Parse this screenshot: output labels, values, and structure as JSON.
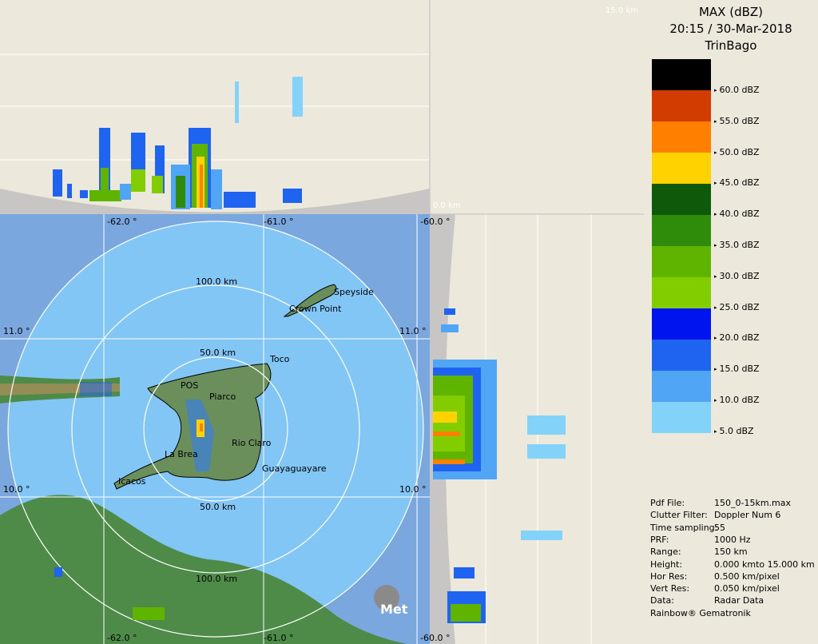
{
  "title": {
    "product": "MAX (dBZ)",
    "datetime": "20:15 / 30-Mar-2018",
    "site": "TrinBago"
  },
  "legend": [
    {
      "label": "60.0 dBZ",
      "color": "#000000"
    },
    {
      "label": "55.0 dBZ",
      "color": "#d23c00"
    },
    {
      "label": "50.0 dBZ",
      "color": "#ff7f00"
    },
    {
      "label": "45.0 dBZ",
      "color": "#ffd200"
    },
    {
      "label": "40.0 dBZ",
      "color": "#0f5a0a"
    },
    {
      "label": "35.0 dBZ",
      "color": "#2e8c0a"
    },
    {
      "label": "30.0 dBZ",
      "color": "#5fb400"
    },
    {
      "label": "25.0 dBZ",
      "color": "#82cd00"
    },
    {
      "label": "20.0 dBZ",
      "color": "#0014f0"
    },
    {
      "label": "15.0 dBZ",
      "color": "#1e64f0"
    },
    {
      "label": "10.0 dBZ",
      "color": "#50a5f5"
    },
    {
      "label": "5.0 dBZ",
      "color": "#82d2fa"
    }
  ],
  "info": [
    {
      "key": "Pdf File:",
      "value": "150_0-15km.max"
    },
    {
      "key": "Clutter Filter:",
      "value": "Doppler Num 6"
    },
    {
      "key": "Time sampling:",
      "value": "55"
    },
    {
      "key": "PRF:",
      "value": "1000 Hz"
    },
    {
      "key": "Range:",
      "value": "150 km"
    },
    {
      "key": "Height:",
      "value": "0.000 kmto 15.000 km"
    },
    {
      "key": "Hor Res:",
      "value": "0.500 km/pixel"
    },
    {
      "key": "Vert Res:",
      "value": "0.050 km/pixel"
    },
    {
      "key": "Data:",
      "value": "Radar Data"
    }
  ],
  "footer": "Rainbow® Gematronik",
  "map": {
    "lon_top": [
      "-62.0 °",
      "-61.0 °",
      "-60.0 °"
    ],
    "lon_bottom": [
      "-62.0 °",
      "-61.0 °",
      "-60.0 °"
    ],
    "lat_left": [
      "11.0 °",
      "10.0 °"
    ],
    "lat_right": [
      "11.0 °",
      "10.0 °"
    ],
    "rings_upper": [
      "100.0 km",
      "50.0 km"
    ],
    "rings_lower": [
      "50.0 km",
      "100.0 km"
    ],
    "places": [
      "Speyside",
      "Crown Point",
      "Toco",
      "POS",
      "Piarco",
      "Rio Claro",
      "La Brea",
      "Guayaguayare",
      "Icacos"
    ]
  },
  "heights": {
    "top": "15.0 km",
    "bottom": "0.0 km"
  },
  "logo_text": "Met"
}
